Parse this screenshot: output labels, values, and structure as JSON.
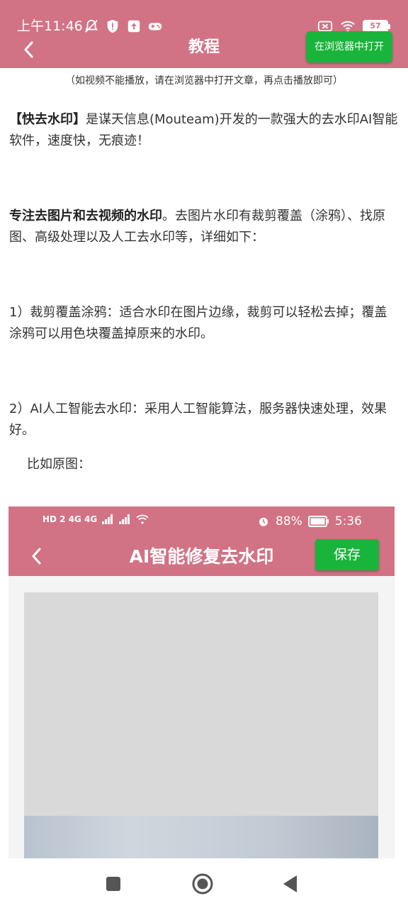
{
  "colors": {
    "accent": "#d27285",
    "button_green": "#19b43c"
  },
  "status_bar": {
    "time": "上午11:46",
    "left_icons": [
      "muted-bell-icon",
      "shield-icon",
      "upload-icon",
      "gamepad-icon"
    ],
    "right_icons": [
      "sim-error-icon",
      "wifi-icon"
    ],
    "battery": "57"
  },
  "header": {
    "back_icon": "chevron-left-icon",
    "title": "教程",
    "open_browser_label": "在浏览器中打开"
  },
  "content": {
    "hint": "（如视频不能播放，请在浏览器中打开文章，再点击播放即可）",
    "p1_bold": "【快去水印】",
    "p1_text": "是谋天信息(Mouteam)开发的一款强大的去水印AI智能软件，速度快，无痕迹！",
    "p2_bold": "专注去图片和去视频的水印",
    "p2_text": "。去图片水印有裁剪覆盖（涂鸦）、找原图、高级处理以及人工去水印等，详细如下：",
    "p3": "1）裁剪覆盖涂鸦：适合水印在图片边缘，裁剪可以轻松去掉；覆盖涂鸦可以用色块覆盖掉原来的水印。",
    "p4": "2）AI人工智能去水印：采用人工智能算法，服务器快速处理，效果好。",
    "p5": "比如原图："
  },
  "embedded_screenshot": {
    "status_left": "HD 2 4G 4G",
    "status_battery": "88%",
    "status_time": "5:36",
    "title": "AI智能修复去水印",
    "save_label": "保存"
  },
  "nav_bar": {
    "icons": [
      "recent-apps-icon",
      "home-icon",
      "back-triangle-icon"
    ]
  }
}
